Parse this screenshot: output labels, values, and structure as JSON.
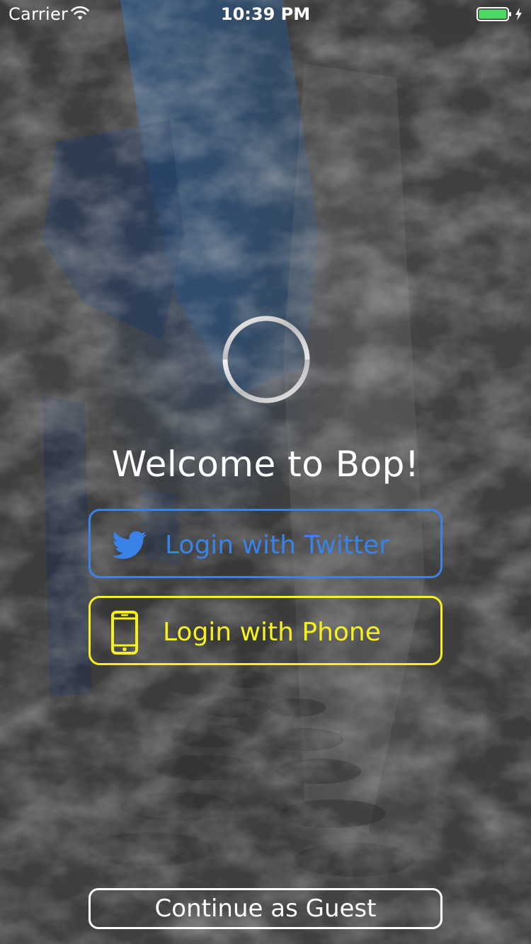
{
  "status_bar": {
    "carrier": "Carrier",
    "time": "10:39 PM",
    "wifi_icon": "wifi-icon",
    "battery_icon": "battery-icon",
    "battery_level": 1.0,
    "charging": true
  },
  "logo": {
    "icon": "bop-logo"
  },
  "welcome": {
    "title": "Welcome to Bop!"
  },
  "login": {
    "twitter": {
      "label": "Login with Twitter",
      "icon": "twitter-bird-icon",
      "color": "#3b82e6"
    },
    "phone": {
      "label": "Login with Phone",
      "icon": "phone-icon",
      "color": "#f6f01f"
    }
  },
  "guest": {
    "label": "Continue as Guest"
  }
}
